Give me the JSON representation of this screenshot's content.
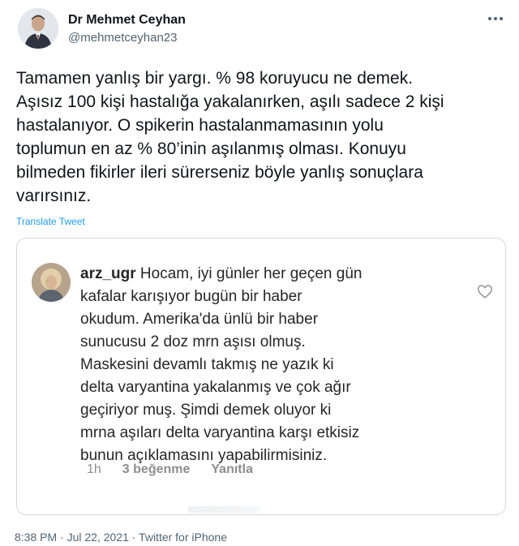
{
  "author": {
    "name": "Dr Mehmet Ceyhan",
    "handle": "@mehmetceyhan23"
  },
  "tweet": {
    "lines": [
      "Tamamen yanlış bir yargı. % 98 koruyucu ne demek.",
      "Aşısız 100 kişi hastalığa yakalanırken, aşılı sadece 2 kişi",
      "hastalanıyor. O spikerin hastalanmamasının yolu",
      "toplumun en az % 80’inin aşılanmış olması. Konuyu",
      "bilmeden fikirler ileri sürerseniz böyle yanlış sonuçlara",
      "varırsınız."
    ],
    "translate_label": "Translate Tweet"
  },
  "quoted_comment": {
    "username": "arz_ugr",
    "lines": [
      " Hocam, iyi günler her geçen gün",
      "kafalar karışıyor bugün bir haber",
      "okudum. Amerika'da ünlü bir haber",
      "sunucusu 2 doz mrn aşısı olmuş.",
      "Maskesini devamlı takmış ne yazık ki",
      "delta varyantina yakalanmış ve çok ağır",
      "geçiriyor muş. Şimdi demek oluyor ki",
      "mrna aşıları delta varyantina karşı etkisiz",
      "bunun açıklamasını yapabilirmisiniz."
    ],
    "time": "1h",
    "likes": "3 beğenme",
    "reply_label": "Yanıtla"
  },
  "footer": {
    "timestamp": "8:38 PM · Jul 22, 2021 · Twitter for iPhone"
  },
  "icons": {
    "more": "more-dots-icon",
    "like": "heart-outline-icon"
  },
  "colors": {
    "link": "#1d9bf0",
    "secondary_text": "#536471",
    "border": "#cfd9de"
  }
}
